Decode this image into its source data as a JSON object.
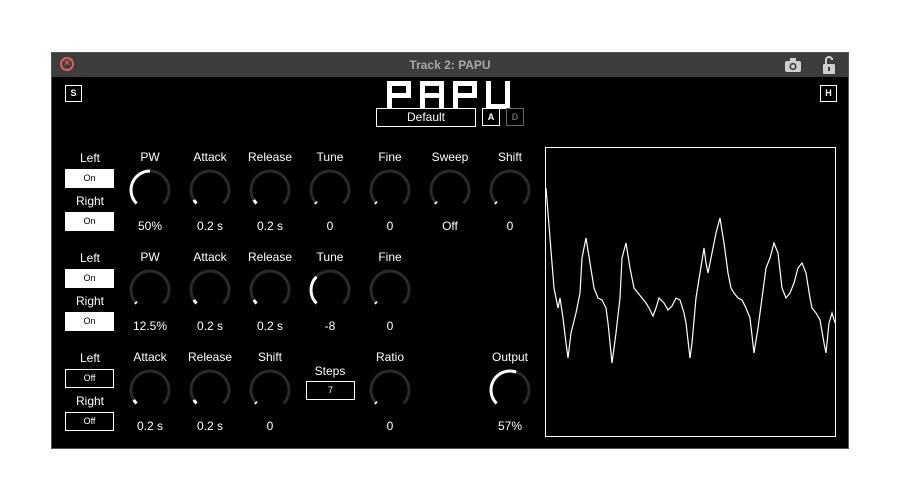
{
  "window": {
    "title": "Track 2: PAPU"
  },
  "header": {
    "logo_text": "PAPU",
    "s_label": "S",
    "h_label": "H",
    "preset": "Default",
    "a_label": "A",
    "d_label": "D"
  },
  "row1": {
    "left_label": "Left",
    "left_state": "On",
    "right_label": "Right",
    "right_state": "On",
    "pw": {
      "label": "PW",
      "value": "50%",
      "level": 0.5
    },
    "attack": {
      "label": "Attack",
      "value": "0.2 s",
      "level": 0.05
    },
    "release": {
      "label": "Release",
      "value": "0.2 s",
      "level": 0.05
    },
    "tune": {
      "label": "Tune",
      "value": "0",
      "level": 0
    },
    "fine": {
      "label": "Fine",
      "value": "0",
      "level": 0
    },
    "sweep": {
      "label": "Sweep",
      "value": "Off",
      "level": 0
    },
    "shift": {
      "label": "Shift",
      "value": "0",
      "level": 0
    }
  },
  "row2": {
    "left_label": "Left",
    "left_state": "On",
    "right_label": "Right",
    "right_state": "On",
    "pw": {
      "label": "PW",
      "value": "12.5%",
      "level": 0
    },
    "attack": {
      "label": "Attack",
      "value": "0.2 s",
      "level": 0.05
    },
    "release": {
      "label": "Release",
      "value": "0.2 s",
      "level": 0.05
    },
    "tune": {
      "label": "Tune",
      "value": "-8",
      "level": 0.33
    },
    "fine": {
      "label": "Fine",
      "value": "0",
      "level": 0
    }
  },
  "row3": {
    "left_label": "Left",
    "left_state": "Off",
    "right_label": "Right",
    "right_state": "Off",
    "attack": {
      "label": "Attack",
      "value": "0.2 s",
      "level": 0.05
    },
    "release": {
      "label": "Release",
      "value": "0.2 s",
      "level": 0.05
    },
    "shift": {
      "label": "Shift",
      "value": "0",
      "level": 0
    },
    "steps": {
      "label": "Steps",
      "value": "7"
    },
    "ratio": {
      "label": "Ratio",
      "value": "0",
      "level": 0
    },
    "output": {
      "label": "Output",
      "value": "57%",
      "level": 0.57
    }
  },
  "colors": {
    "background": "#000000",
    "titlebar": "#3d3d3d",
    "knob_track": "#2a2a2a",
    "knob_fill": "#ffffff",
    "close_red": "#e06060"
  },
  "icons": [
    "close-icon",
    "camera-icon",
    "lock-icon"
  ]
}
